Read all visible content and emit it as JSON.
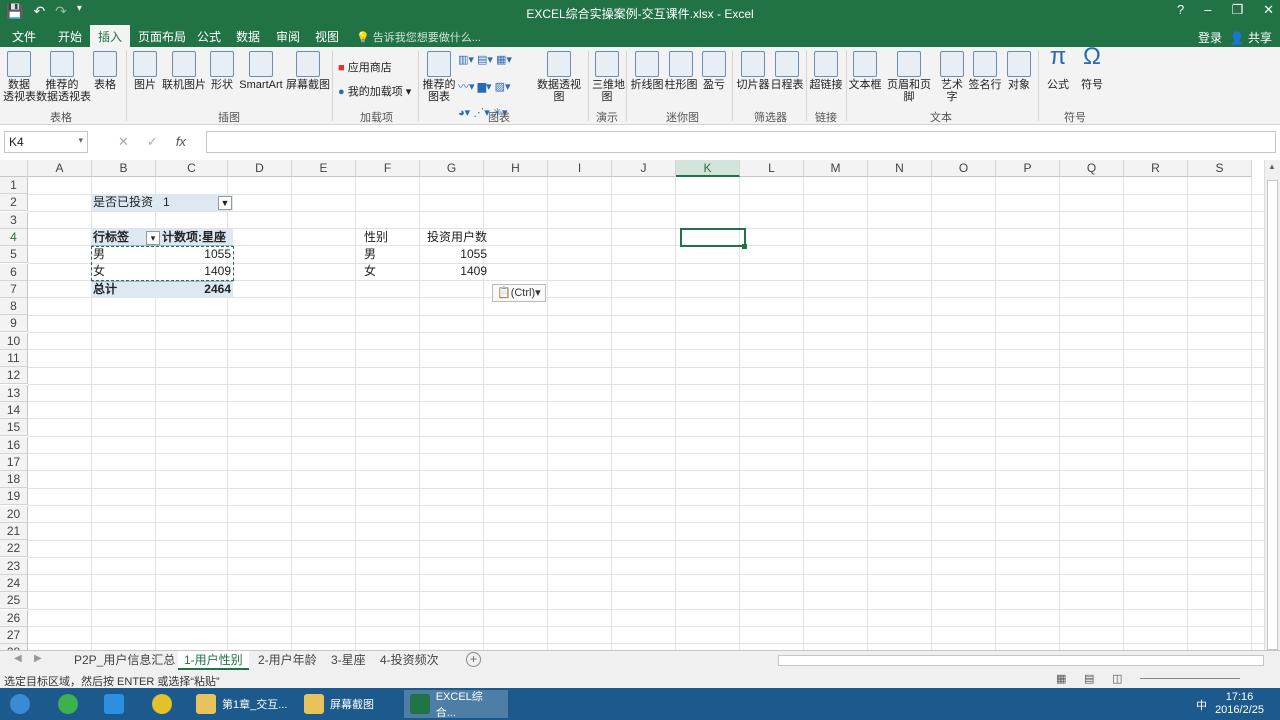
{
  "window": {
    "title": "EXCEL综合实操案例-交互课件.xlsx - Excel",
    "buttons": [
      "?",
      "–",
      "❐",
      "✕"
    ]
  },
  "quick_access": [
    "💾",
    "↶",
    "↷",
    "▾"
  ],
  "ribbon_tabs": [
    "文件",
    "开始",
    "插入",
    "页面布局",
    "公式",
    "数据",
    "审阅",
    "视图"
  ],
  "tellme": "告诉我您想要做什么...",
  "account": {
    "login": "登录",
    "share": "共享"
  },
  "ribbon": {
    "groups": [
      "表格",
      "插图",
      "加载项",
      "图表",
      "演示",
      "迷你图",
      "筛选器",
      "链接",
      "文本",
      "符号"
    ],
    "buttons": {
      "pivot": "数据\n透视表",
      "rec_pivot": "推荐的\n数据透视表",
      "table": "表格",
      "picture": "图片",
      "online_picture": "联机图片",
      "shapes": "形状",
      "smartart": "SmartArt",
      "screenshot": "屏幕截图",
      "app_store": "应用商店",
      "my_addins": "我的加载项",
      "rec_charts": "推荐的\n图表",
      "pivot_chart": "数据透视图",
      "map3d": "三维地\n图",
      "line": "折线图",
      "column": "柱形图",
      "winloss": "盈亏",
      "slicer": "切片器",
      "timeline": "日程表",
      "hyperlink": "超链接",
      "textbox": "文本框",
      "header_footer": "页眉和页脚",
      "wordart": "艺术字",
      "signature": "签名行",
      "object": "对象",
      "equation": "公式",
      "symbol": "符号"
    }
  },
  "formula_bar": {
    "name_box": "K4",
    "fx": "fx",
    "formula": ""
  },
  "columns": [
    "A",
    "B",
    "C",
    "D",
    "E",
    "F",
    "G",
    "H",
    "I",
    "J",
    "K",
    "L",
    "M",
    "N",
    "O",
    "P",
    "Q",
    "R",
    "S"
  ],
  "rows": [
    "1",
    "2",
    "3",
    "4",
    "5",
    "6",
    "7",
    "8",
    "9",
    "10",
    "11",
    "12",
    "13",
    "14",
    "15",
    "16",
    "17",
    "18",
    "19",
    "20",
    "21",
    "22",
    "23",
    "24",
    "25",
    "26",
    "27",
    "28"
  ],
  "selected_cell": "K4",
  "pivot": {
    "filter_label": "是否已投资",
    "filter_value": "1",
    "row_label_header": "行标签",
    "value_header": "计数项:星座",
    "rows": [
      {
        "label": "男",
        "value": "1055"
      },
      {
        "label": "女",
        "value": "1409"
      }
    ],
    "total_label": "总计",
    "total_value": "2464"
  },
  "copy_table": {
    "headers": [
      "性别",
      "投资用户数"
    ],
    "rows": [
      {
        "label": "男",
        "value": "1055"
      },
      {
        "label": "女",
        "value": "1409"
      }
    ]
  },
  "paste_options": "(Ctrl)▾",
  "sheets": [
    "P2P_用户信息汇总",
    "1-用户性别",
    "2-用户年龄",
    "3-星座",
    "4-投资频次"
  ],
  "active_sheet": "1-用户性别",
  "status": {
    "message": "选定目标区域，然后按 ENTER 或选择“粘贴”"
  },
  "taskbar": {
    "items": [
      "第1章_交互...",
      "屏幕截图",
      "EXCEL综合..."
    ],
    "time": "17:16",
    "date": "2016/2/25",
    "ime": "中"
  }
}
